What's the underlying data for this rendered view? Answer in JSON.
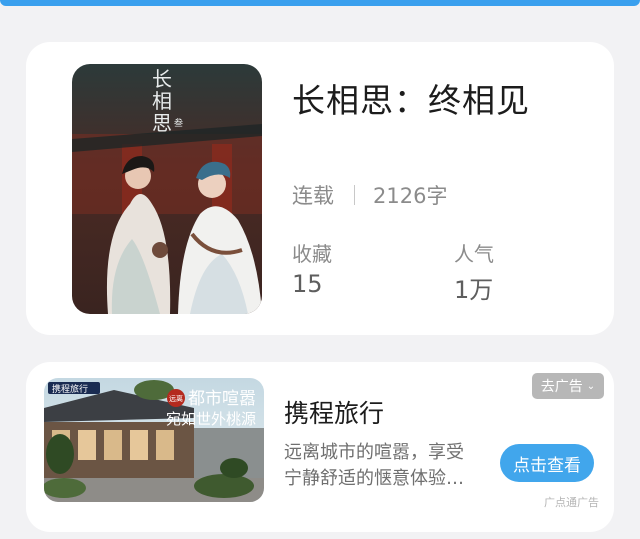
{
  "book": {
    "title": "长相思：终相见",
    "status": "连载",
    "word_count": "2126字",
    "favorites_label": "收藏",
    "favorites_value": "15",
    "popularity_label": "人气",
    "popularity_value": "1万",
    "cover": {
      "title_text": "长相思",
      "badge_text": "叁"
    }
  },
  "ad": {
    "title": "携程旅行",
    "description": "远离城市的喧嚣，享受宁静舒适的惬意体验…",
    "remove_label": "去广告",
    "cta_label": "点击查看",
    "source_label": "广点通广告",
    "image": {
      "brand_text": "携程旅行",
      "stamp_text": "远离",
      "headline_line1": "都市喧嚣",
      "headline_line2": "宛如世外桃源"
    }
  },
  "colors": {
    "accent": "#41a6ec",
    "top_strip": "#3aa0ee"
  }
}
